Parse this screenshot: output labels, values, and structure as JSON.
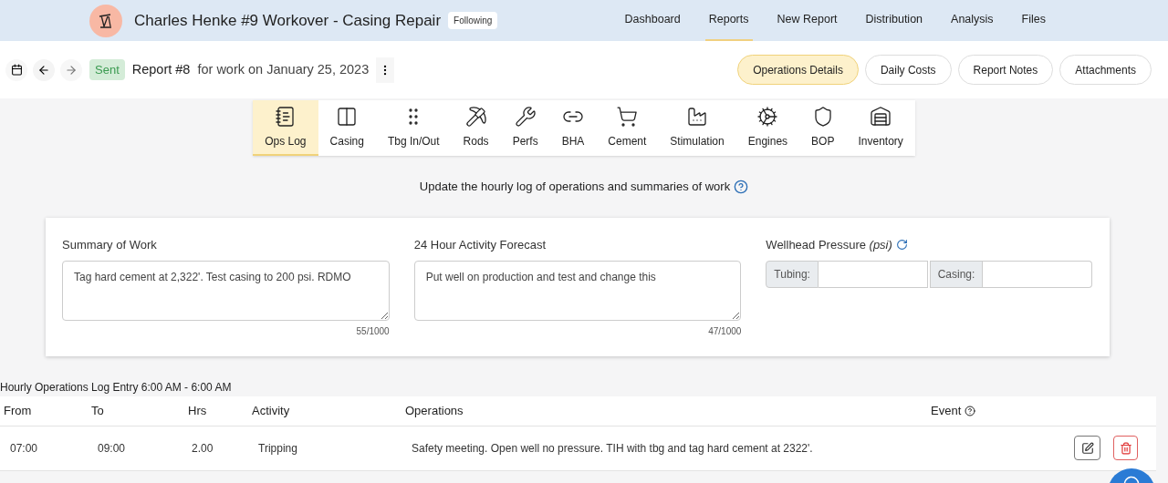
{
  "header": {
    "title": "Charles Henke #9 Workover - Casing Repair",
    "badge": "Following",
    "nav": [
      {
        "label": "Dashboard",
        "selected": false
      },
      {
        "label": "Reports",
        "selected": true
      },
      {
        "label": "New Report",
        "selected": false
      },
      {
        "label": "Distribution",
        "selected": false
      },
      {
        "label": "Analysis",
        "selected": false
      },
      {
        "label": "Files",
        "selected": false
      }
    ]
  },
  "report_bar": {
    "status": "Sent",
    "title": "Report #8",
    "subtitle": "for work on January 25, 2023",
    "sections": [
      {
        "label": "Operations Details",
        "selected": true
      },
      {
        "label": "Daily Costs",
        "selected": false
      },
      {
        "label": "Report Notes",
        "selected": false
      },
      {
        "label": "Attachments",
        "selected": false
      }
    ]
  },
  "tools": [
    {
      "label": "Ops Log",
      "selected": true
    },
    {
      "label": "Casing",
      "selected": false
    },
    {
      "label": "Tbg In/Out",
      "selected": false
    },
    {
      "label": "Rods",
      "selected": false
    },
    {
      "label": "Perfs",
      "selected": false
    },
    {
      "label": "BHA",
      "selected": false
    },
    {
      "label": "Cement",
      "selected": false
    },
    {
      "label": "Stimulation",
      "selected": false
    },
    {
      "label": "Engines",
      "selected": false
    },
    {
      "label": "BOP",
      "selected": false
    },
    {
      "label": "Inventory",
      "selected": false
    }
  ],
  "instruction": "Update the hourly log of operations and summaries of work",
  "summary": {
    "label": "Summary of Work",
    "value": "Tag hard cement at 2,322'. Test casing to 200 psi. RDMO",
    "count": "55/1000"
  },
  "forecast": {
    "label": "24 Hour Activity Forecast",
    "value": "Put well on production and test and change this",
    "count": "47/1000"
  },
  "pressure": {
    "label": "Wellhead Pressure",
    "unit": "(psi)",
    "fields": [
      "Tubing:",
      "Casing:"
    ]
  },
  "log": {
    "title": "Hourly Operations Log Entry 6:00 AM - 6:00 AM",
    "columns": [
      "From",
      "To",
      "Hrs",
      "Activity",
      "Operations",
      "Event"
    ],
    "rows": [
      {
        "from": "07:00",
        "to": "09:00",
        "hrs": "2.00",
        "activity": "Tripping",
        "operations": "Safety meeting. Open well no pressure. TIH with tbg and tag hard cement at 2322'."
      }
    ]
  }
}
